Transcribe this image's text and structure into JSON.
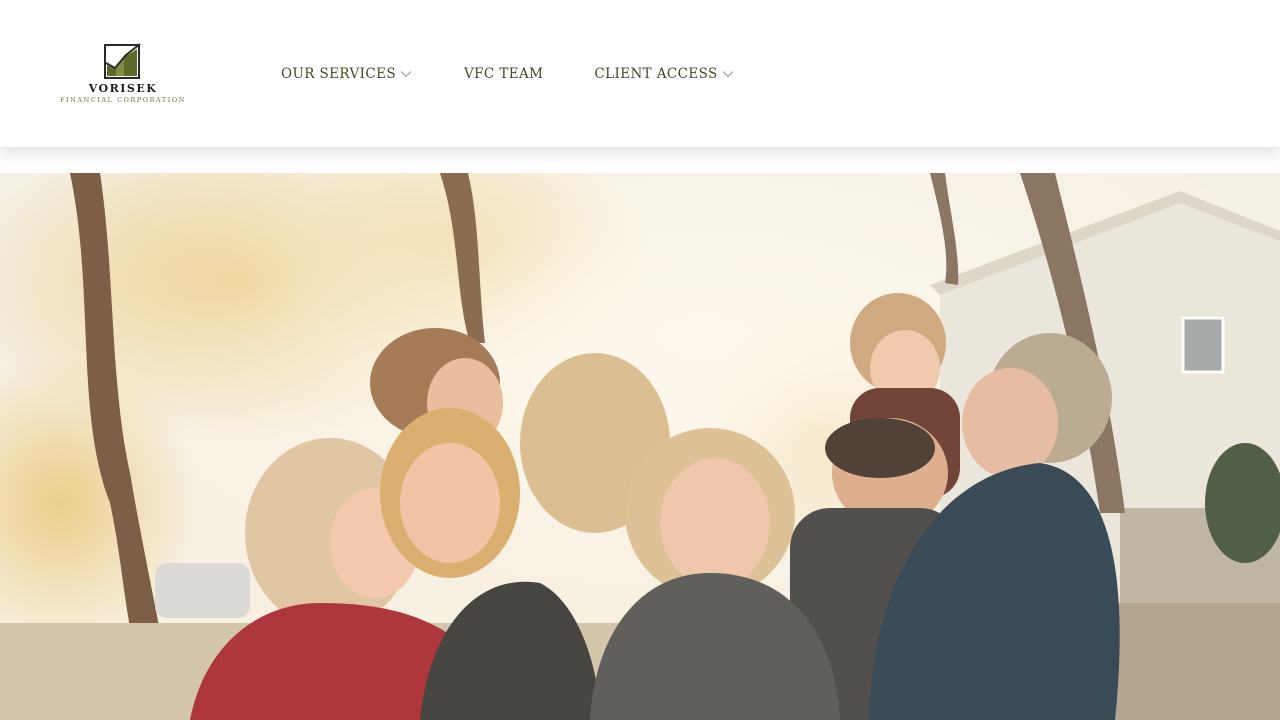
{
  "brand": {
    "name": "VORISEK",
    "subtitle": "FINANCIAL CORPORATION"
  },
  "nav": {
    "items": [
      {
        "label": "OUR SERVICES",
        "has_dropdown": true
      },
      {
        "label": "VFC TEAM",
        "has_dropdown": false
      },
      {
        "label": "CLIENT ACCESS",
        "has_dropdown": true
      }
    ]
  },
  "colors": {
    "nav_text": "#3f4a22",
    "logo_green": "#5c6b2a",
    "header_bg": "#ffffff"
  },
  "hero": {
    "image": "family-photo"
  }
}
